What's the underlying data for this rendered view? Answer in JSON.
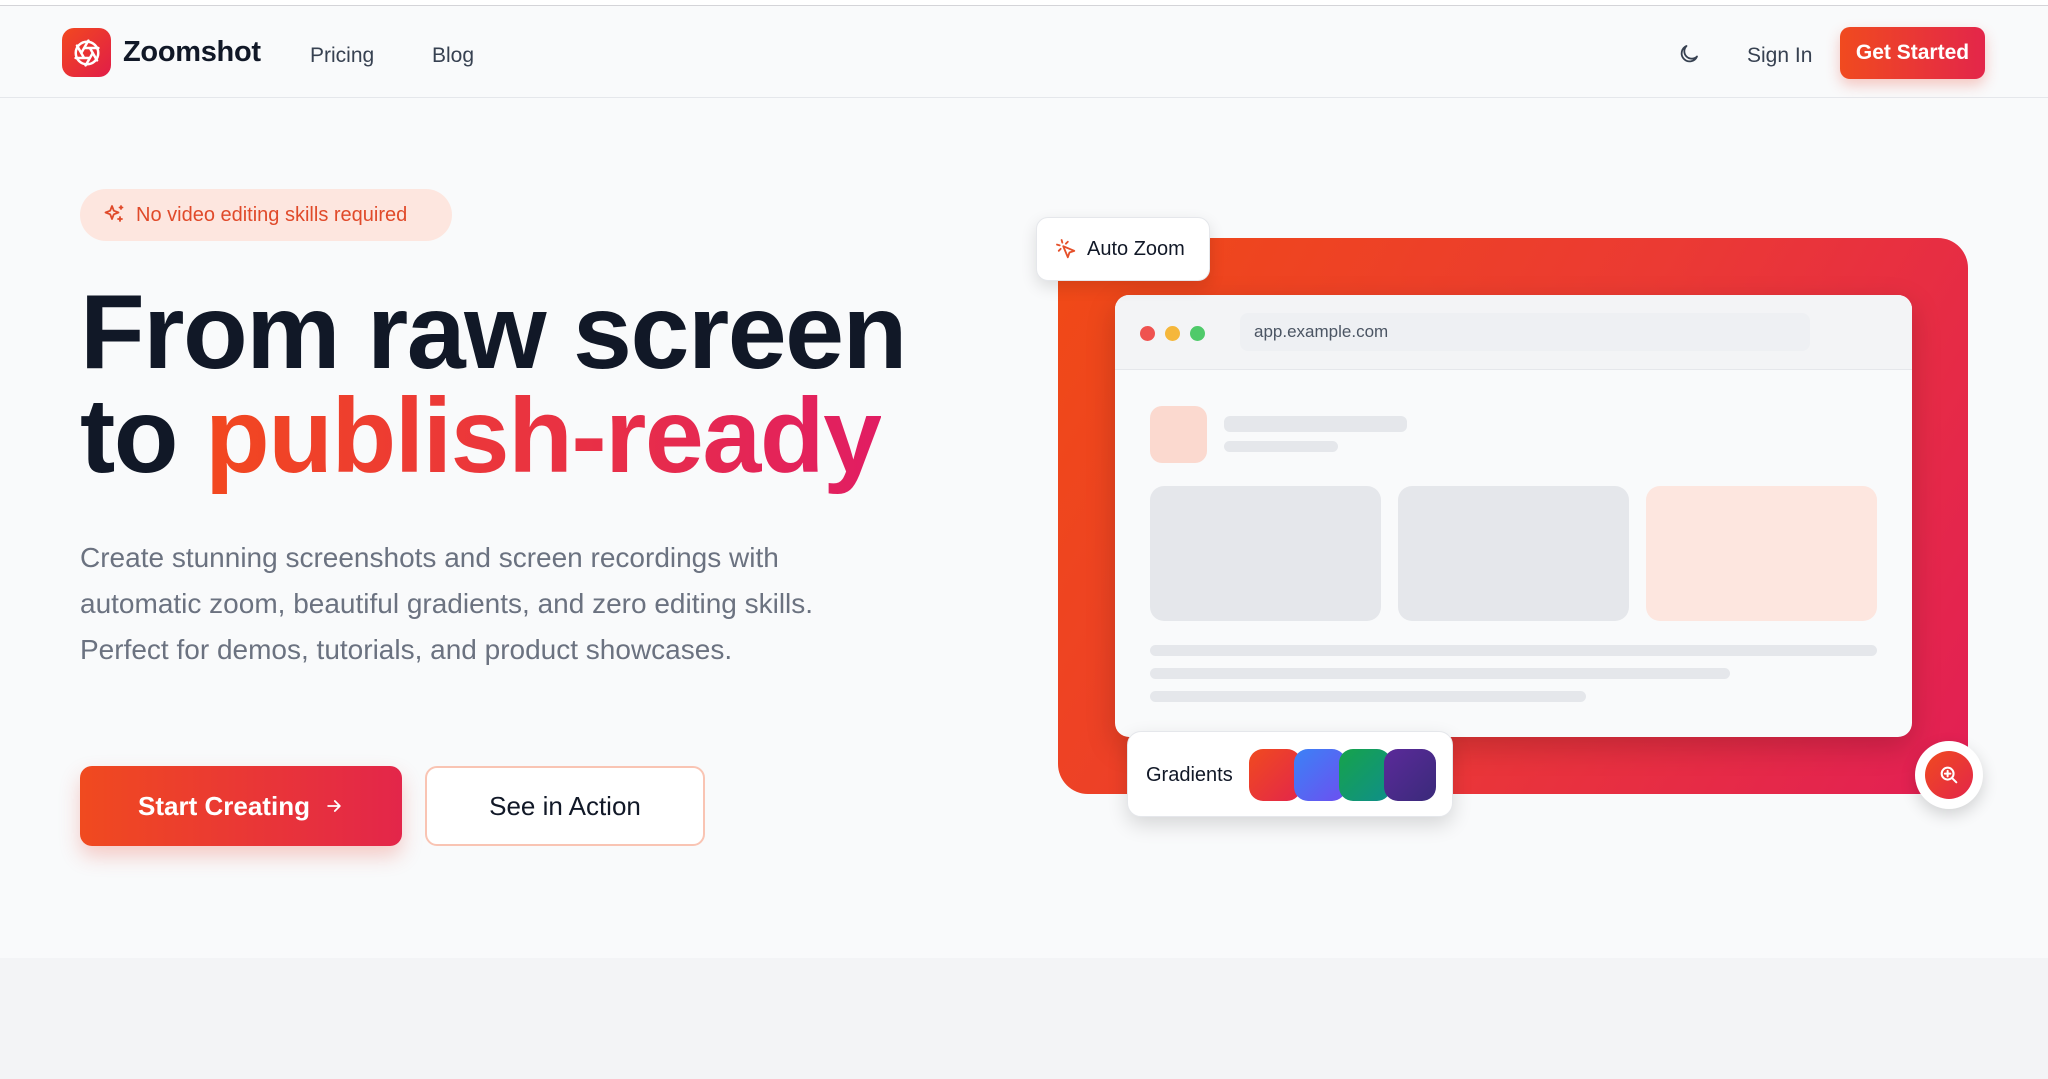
{
  "brand": {
    "name": "Zoomshot",
    "accent_start": "#f2481f",
    "accent_end": "#e11d48"
  },
  "nav": {
    "links": [
      "Pricing",
      "Blog"
    ],
    "theme_icon": "moon-icon",
    "sign_in": "Sign In",
    "cta": "Get Started"
  },
  "hero": {
    "badge": "No video editing skills required",
    "headline_line1": "From raw screen",
    "headline_to": "to",
    "headline_accent": "publish-ready",
    "subtext": "Create stunning screenshots and screen recordings with automatic zoom, beautiful gradients, and zero editing skills. Perfect for demos, tutorials, and product showcases.",
    "primary_button": "Start Creating",
    "secondary_button": "See in Action"
  },
  "illustration": {
    "auto_zoom_label": "Auto Zoom",
    "url": "app.example.com",
    "gradients_label": "Gradients",
    "swatch_colors": [
      "#ef3a33",
      "#4f6cf0",
      "#1f9e7a",
      "#4a2a8a"
    ]
  }
}
